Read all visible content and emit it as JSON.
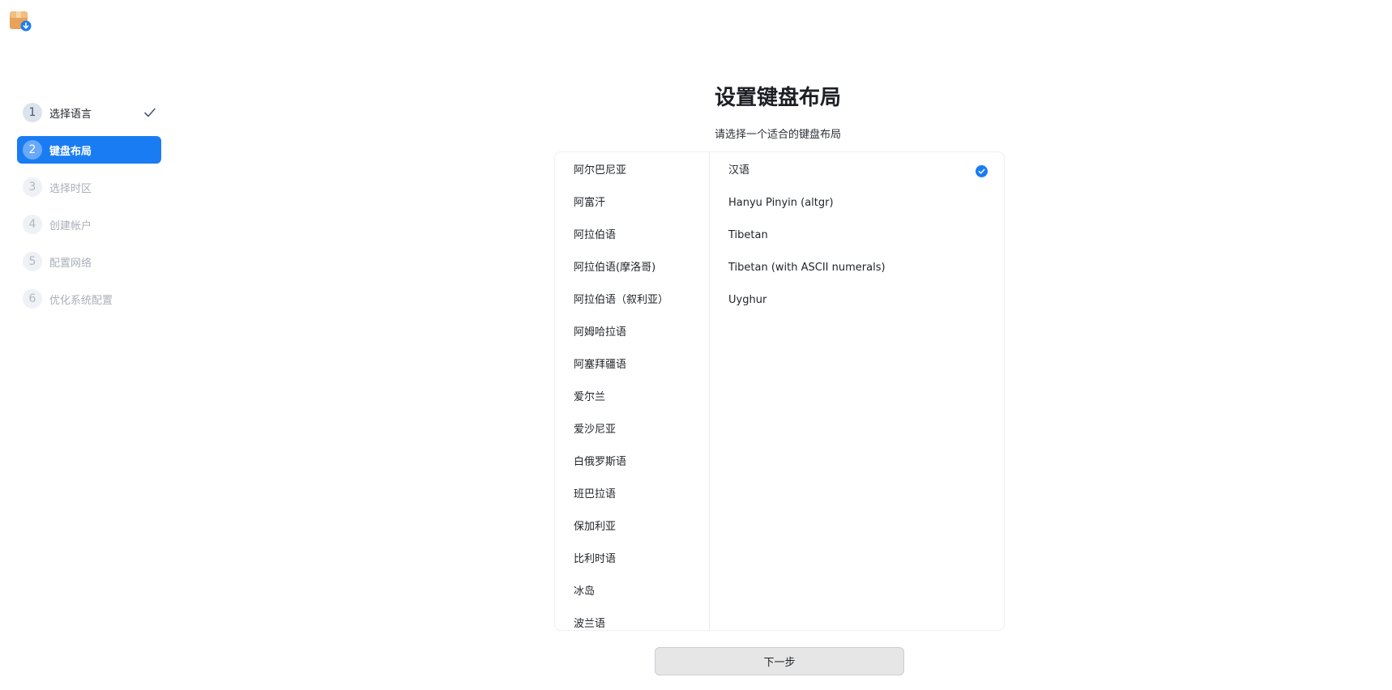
{
  "app": {
    "icon": "package-installer-icon"
  },
  "sidebar": {
    "steps": [
      {
        "number": "1",
        "label": "选择语言",
        "state": "done"
      },
      {
        "number": "2",
        "label": "键盘布局",
        "state": "active"
      },
      {
        "number": "3",
        "label": "选择时区",
        "state": "disabled"
      },
      {
        "number": "4",
        "label": "创建帐户",
        "state": "disabled"
      },
      {
        "number": "5",
        "label": "配置网络",
        "state": "disabled"
      },
      {
        "number": "6",
        "label": "优化系统配置",
        "state": "disabled"
      }
    ]
  },
  "main": {
    "title": "设置键盘布局",
    "subtitle": "请选择一个适合的键盘布局",
    "languages": [
      "阿尔巴尼亚",
      "阿富汗",
      "阿拉伯语",
      "阿拉伯语(摩洛哥)",
      "阿拉伯语（叙利亚）",
      "阿姆哈拉语",
      "阿塞拜疆语",
      "爱尔兰",
      "爱沙尼亚",
      "白俄罗斯语",
      "班巴拉语",
      "保加利亚",
      "比利时语",
      "冰岛",
      "波兰语"
    ],
    "layouts": [
      {
        "label": "汉语",
        "selected": true
      },
      {
        "label": "Hanyu Pinyin (altgr)",
        "selected": false
      },
      {
        "label": "Tibetan",
        "selected": false
      },
      {
        "label": "Tibetan (with ASCII numerals)",
        "selected": false
      },
      {
        "label": "Uyghur",
        "selected": false
      }
    ],
    "next_label": "下一步"
  },
  "colors": {
    "accent": "#1a7cf3",
    "button_bg": "#e6e6e6"
  }
}
